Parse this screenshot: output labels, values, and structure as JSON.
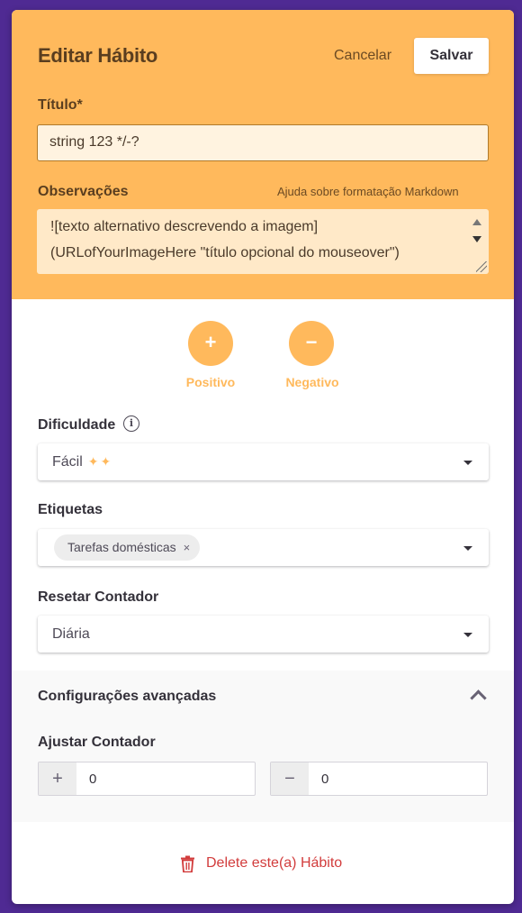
{
  "header": {
    "title": "Editar Hábito",
    "cancel_label": "Cancelar",
    "save_label": "Salvar"
  },
  "title_field": {
    "label": "Título*",
    "value": "string 123 */-?"
  },
  "notes_field": {
    "label": "Observações",
    "help_link": "Ajuda sobre formatação Markdown",
    "line1": "![texto alternativo descrevendo a imagem]",
    "line2": "(URLofYourImageHere \"título opcional do mouseover\")"
  },
  "direction": {
    "positive_symbol": "+",
    "positive_label": "Positivo",
    "negative_symbol": "−",
    "negative_label": "Negativo"
  },
  "difficulty": {
    "label": "Dificuldade",
    "value": "Fácil",
    "stars": "✦✦"
  },
  "tags": {
    "label": "Etiquetas",
    "items": [
      {
        "label": "Tarefas domésticas",
        "remove": "×"
      }
    ]
  },
  "reset": {
    "label": "Resetar Contador",
    "value": "Diária"
  },
  "advanced": {
    "title": "Configurações avançadas",
    "adjust_label": "Ajustar Contador",
    "positive_sign": "+",
    "positive_value": "0",
    "negative_sign": "−",
    "negative_value": "0"
  },
  "footer": {
    "delete_label": "Delete este(a) Hábito"
  },
  "colors": {
    "header_bg": "#ffb95c",
    "page_bg": "#4f2a93",
    "delete": "#d23c3c"
  }
}
